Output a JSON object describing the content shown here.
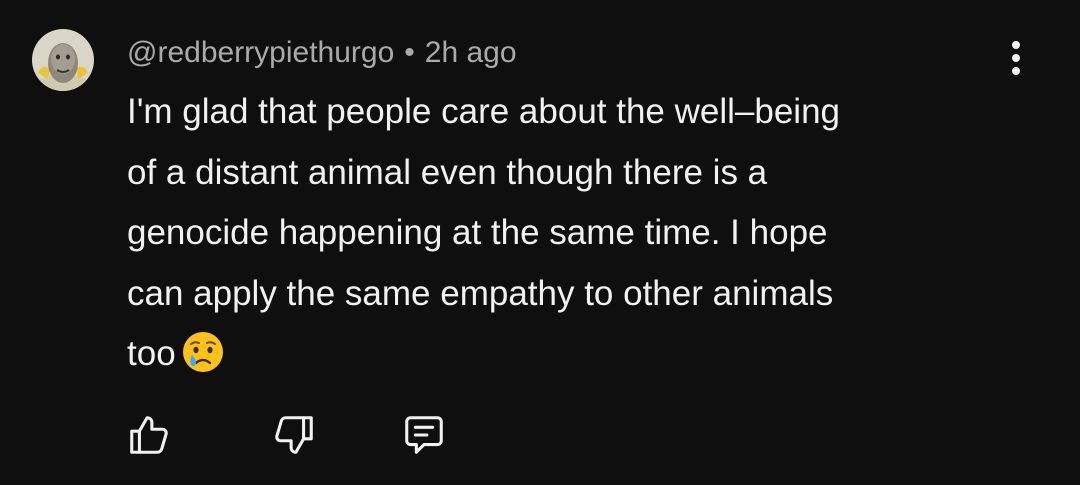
{
  "comment": {
    "author": "@redberrypiethurgo",
    "separator": "•",
    "timestamp": "2h ago",
    "text_lines": [
      "I'm glad that people care about the well–being",
      "of a distant animal even though there is a",
      "genocide happening at the same time.  I hope",
      "can apply the same empathy to other animals",
      "too"
    ],
    "emoji": "😢"
  },
  "actions": {
    "like_icon": "thumbs-up-icon",
    "dislike_icon": "thumbs-down-icon",
    "reply_icon": "comment-icon",
    "more_icon": "more-vertical-icon"
  },
  "colors": {
    "background": "#0f0f0f",
    "text_primary": "#f1f1f1",
    "text_secondary": "#aaaaaa"
  }
}
